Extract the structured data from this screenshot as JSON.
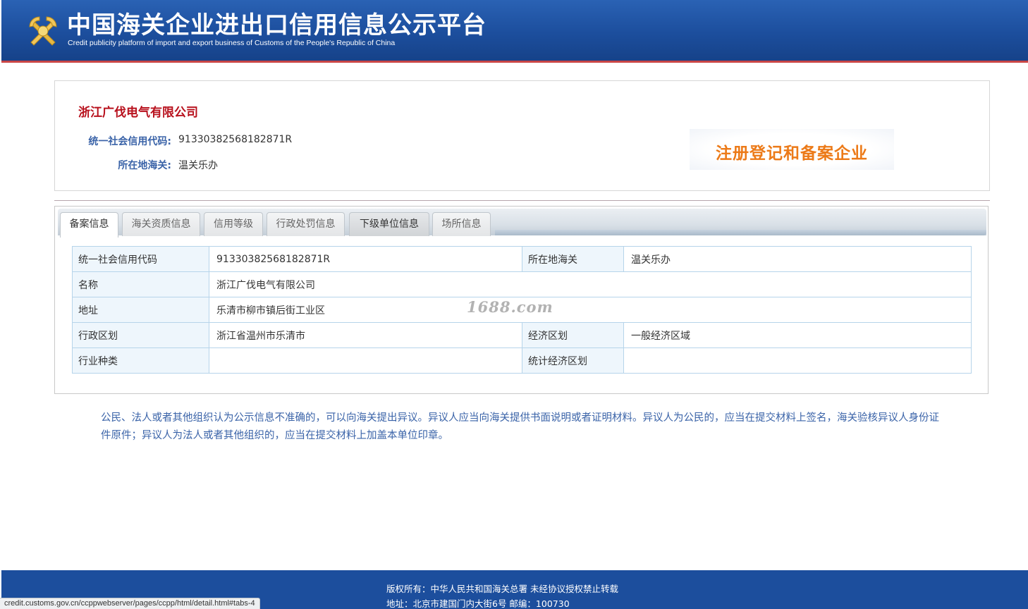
{
  "header": {
    "title": "中国海关企业进出口信用信息公示平台",
    "subtitle": "Credit publicity platform of import and export business of Customs of the People's Republic of China"
  },
  "company": {
    "name": "浙江广伐电气有限公司",
    "credit_code_label": "统一社会信用代码:",
    "credit_code": "91330382568182871R",
    "customs_label": "所在地海关:",
    "customs": "温关乐办",
    "badge": "注册登记和备案企业"
  },
  "tabs": [
    {
      "label": "备案信息",
      "state": "active"
    },
    {
      "label": "海关资质信息",
      "state": "normal"
    },
    {
      "label": "信用等级",
      "state": "normal"
    },
    {
      "label": "行政处罚信息",
      "state": "normal"
    },
    {
      "label": "下级单位信息",
      "state": "hover"
    },
    {
      "label": "场所信息",
      "state": "normal"
    }
  ],
  "table": {
    "credit_code_label": "统一社会信用代码",
    "credit_code": "91330382568182871R",
    "customs_label": "所在地海关",
    "customs": "温关乐办",
    "name_label": "名称",
    "name": "浙江广伐电气有限公司",
    "address_label": "地址",
    "address": "乐清市柳市镇后街工业区",
    "admin_region_label": "行政区划",
    "admin_region": "浙江省温州市乐清市",
    "econ_region_label": "经济区划",
    "econ_region": "一般经济区域",
    "industry_label": "行业种类",
    "industry": "",
    "stat_region_label": "统计经济区划",
    "stat_region": ""
  },
  "watermark": "1688.com",
  "notice": "公民、法人或者其他组织认为公示信息不准确的，可以向海关提出异议。异议人应当向海关提供书面说明或者证明材料。异议人为公民的，应当在提交材料上签名，海关验核异议人身份证件原件；异议人为法人或者其他组织的，应当在提交材料上加盖本单位印章。",
  "footer": {
    "copyright": "版权所有：中华人民共和国海关总署   未经协议授权禁止转载",
    "address": "地址：北京市建国门内大街6号 邮编：100730"
  },
  "status_url": "credit.customs.gov.cn/ccppwebserver/pages/ccpp/html/detail.html#tabs-4",
  "colors": {
    "header_blue": "#1c4e9d",
    "company_red": "#b8111d",
    "label_blue": "#3a63a8",
    "badge_orange": "#ec7a18",
    "table_header_bg": "#eef6fc"
  }
}
